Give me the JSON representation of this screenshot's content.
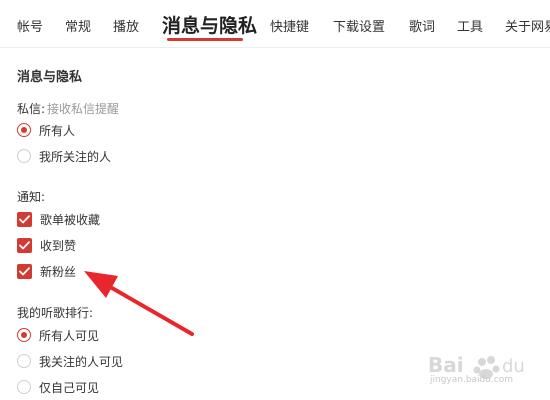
{
  "tabs": [
    {
      "label": "帐号"
    },
    {
      "label": "常规"
    },
    {
      "label": "播放"
    },
    {
      "label": "消息与隐私",
      "active": true
    },
    {
      "label": "快捷键"
    },
    {
      "label": "下载设置"
    },
    {
      "label": "歌词"
    },
    {
      "label": "工具"
    },
    {
      "label": "关于网易"
    }
  ],
  "section_title": "消息与隐私",
  "private_message": {
    "label": "私信:",
    "hint": "接收私信提醒",
    "options": [
      {
        "label": "所有人",
        "checked": true
      },
      {
        "label": "我所关注的人",
        "checked": false
      }
    ]
  },
  "notifications": {
    "label": "通知:",
    "options": [
      {
        "label": "歌单被收藏",
        "checked": true
      },
      {
        "label": "收到赞",
        "checked": true
      },
      {
        "label": "新粉丝",
        "checked": true
      }
    ]
  },
  "ranking": {
    "label": "我的听歌排行:",
    "options": [
      {
        "label": "所有人可见",
        "checked": true
      },
      {
        "label": "我关注的人可见",
        "checked": false
      },
      {
        "label": "仅自己可见",
        "checked": false
      }
    ]
  },
  "watermark": {
    "line1": "Bai du",
    "line2": "jingyan.baidu.com"
  },
  "colors": {
    "accent": "#d33a31",
    "annotation_arrow": "#e8262b"
  }
}
